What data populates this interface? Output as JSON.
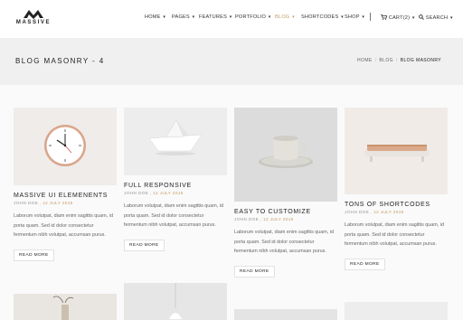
{
  "brand": {
    "name": "MASSIVE"
  },
  "nav": [
    {
      "label": "HOME",
      "caret": "▾",
      "active": false
    },
    {
      "label": "PAGES",
      "caret": "▾",
      "active": false
    },
    {
      "label": "FEATURES",
      "caret": "▾",
      "active": false
    },
    {
      "label": "PORTFOLIO",
      "caret": "▾",
      "active": false
    },
    {
      "label": "BLOG",
      "caret": "▾",
      "active": true
    },
    {
      "label": "SHORTCODES",
      "caret": "▾",
      "active": false
    },
    {
      "label": "SHOP",
      "caret": "▾",
      "active": false
    }
  ],
  "cart": {
    "label": "CART(2)",
    "caret": "▾"
  },
  "search": {
    "label": "SEARCH",
    "caret": "▾"
  },
  "page": {
    "title": "BLOG MASONRY - 4"
  },
  "breadcrumb": {
    "home": "HOME",
    "blog": "BLOG",
    "current": "BLOG MASONRY"
  },
  "posts": [
    {
      "title": "MASSIVE UI ELEMENENTS",
      "author": "JOHN DOE",
      "date": "12 JULY 2015",
      "excerpt": "Laborum volutpat, diam enim sagittis quam, id porta quam. Sed id dolor consectetur fermentum nibh volutpat, accumsan purus.",
      "read_more": "READ MORE",
      "image": "wall-clock"
    },
    {
      "title": "FULL RESPONSIVE",
      "author": "JOHN DOE",
      "date": "12 JULY 2015",
      "excerpt": "Laborum volutpat, diam enim sagittis quam, id porta quam. Sed id dolor consectetur fermentum nibh volutpat, accumsan purus.",
      "read_more": "READ MORE",
      "image": "paper-boat"
    },
    {
      "title": "EASY TO CUSTOMIZE",
      "author": "JOHN DOE",
      "date": "12 JULY 2015",
      "excerpt": "Laborum volutpat, diam enim sagittis quam, id porta quam. Sed id dolor consectetur fermentum nibh volutpat, accumsan purus.",
      "read_more": "READ MORE",
      "image": "cup-and-saucer"
    },
    {
      "title": "TONS OF SHORTCODES",
      "author": "JOHN DOE",
      "date": "12 JULY 2015",
      "excerpt": "Laborum volutpat, diam enim sagittis quam, id porta quam. Sed id dolor consectetur fermentum nibh volutpat, accumsan purus.",
      "read_more": "READ MORE",
      "image": "wooden-tray"
    }
  ],
  "colors": {
    "accent": "#c59b67",
    "title_bar": "#f0f0f0",
    "header": "#ffffff"
  }
}
